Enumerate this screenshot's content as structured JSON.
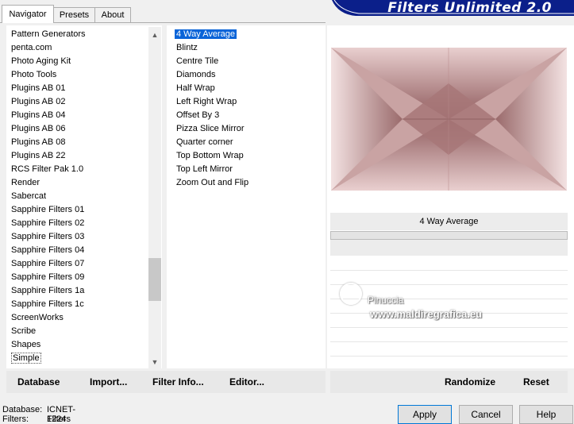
{
  "tabs": [
    "Navigator",
    "Presets",
    "About"
  ],
  "banner_title": "Filters Unlimited 2.0",
  "categories": [
    "Pattern Generators",
    "penta.com",
    "Photo Aging Kit",
    "Photo Tools",
    "Plugins AB 01",
    "Plugins AB 02",
    "Plugins AB 04",
    "Plugins AB 06",
    "Plugins AB 08",
    "Plugins AB 22",
    "RCS Filter Pak 1.0",
    "Render",
    "Sabercat",
    "Sapphire Filters 01",
    "Sapphire Filters 02",
    "Sapphire Filters 03",
    "Sapphire Filters 04",
    "Sapphire Filters 07",
    "Sapphire Filters 09",
    "Sapphire Filters 1a",
    "Sapphire Filters 1c",
    "ScreenWorks",
    "Scribe",
    "Shapes",
    "Simple"
  ],
  "selected_category": "Simple",
  "filters": [
    "4 Way Average",
    "Blintz",
    "Centre Tile",
    "Diamonds",
    "Half Wrap",
    "Left Right Wrap",
    "Offset By 3",
    "Pizza Slice Mirror",
    "Quarter corner",
    "Top Bottom Wrap",
    "Top Left Mirror",
    "Zoom Out and Flip"
  ],
  "selected_filter": "4 Way Average",
  "preview_label": "4 Way Average",
  "watermark": {
    "name": "Pinuccia",
    "site": "www.maldiregrafica.eu"
  },
  "left_buttons": [
    "Database",
    "Import...",
    "Filter Info...",
    "Editor..."
  ],
  "right_buttons": [
    "Randomize",
    "Reset"
  ],
  "window_buttons": [
    "Apply",
    "Cancel",
    "Help"
  ],
  "status": {
    "db_label": "Database:",
    "db_value": "ICNET-Filters",
    "filters_label": "Filters:",
    "filters_value": "1224"
  },
  "colors": {
    "selection": "#0a64d8",
    "banner": "#0b1f8a",
    "preview_light": "#f0dcdc",
    "preview_dark": "#8e5a5c"
  }
}
